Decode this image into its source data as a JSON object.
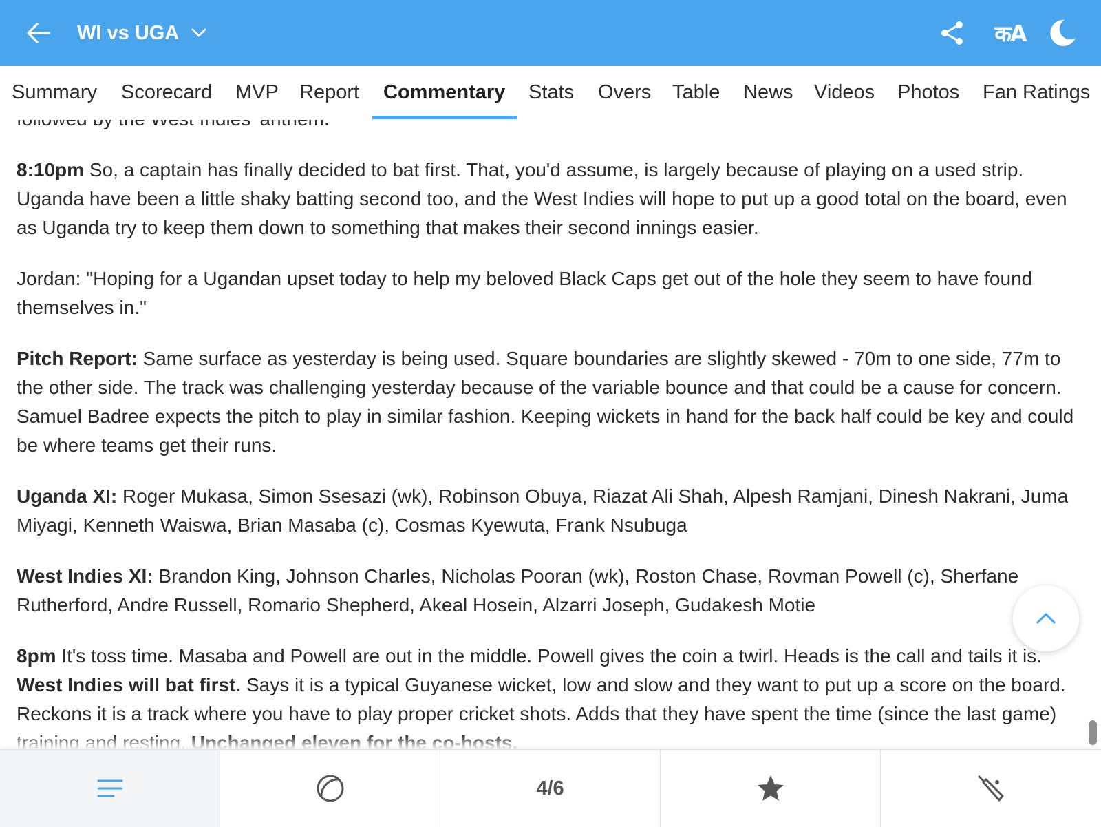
{
  "header": {
    "title": "WI vs UGA",
    "lang_label": "कA",
    "icons": [
      "back-arrow-icon",
      "chevron-down-icon",
      "share-icon",
      "language-icon",
      "dark-mode-moon-icon"
    ],
    "bar_color": "#4aa5ec"
  },
  "tabs": [
    {
      "label": "Summary"
    },
    {
      "label": "Scorecard"
    },
    {
      "label": "MVP"
    },
    {
      "label": "Report"
    },
    {
      "label": "Commentary"
    },
    {
      "label": "Stats"
    },
    {
      "label": "Overs"
    },
    {
      "label": "Table"
    },
    {
      "label": "News"
    },
    {
      "label": "Videos"
    },
    {
      "label": "Photos"
    },
    {
      "label": "Fan Ratings"
    }
  ],
  "active_tab": "Commentary",
  "commentary": {
    "p0": {
      "text": "followed by the West Indies' anthem."
    },
    "p1": {
      "lead": "8:10pm",
      "text": " So, a captain has finally decided to bat first. That, you'd assume, is largely because of playing on a used strip. Uganda have been a little shaky batting second too, and the West Indies will hope to put up a good total on the board, even as Uganda try to keep them down to something that makes their second innings easier."
    },
    "p2": {
      "text": "Jordan: \"Hoping for a Ugandan upset today to help my beloved Black Caps get out of the hole they seem to have found themselves in.\""
    },
    "p3": {
      "lead": "Pitch Report:",
      "text": " Same surface as yesterday is being used. Square boundaries are slightly skewed - 70m to one side, 77m to the other side. The track was challenging yesterday because of the variable bounce and that could be a cause for concern. Samuel Badree expects the pitch to play in similar fashion. Keeping wickets in hand for the back half could be key and could be where teams get their runs."
    },
    "p4": {
      "lead": "Uganda XI:",
      "text": " Roger Mukasa, Simon Ssesazi (wk), Robinson Obuya, Riazat Ali Shah, Alpesh Ramjani, Dinesh Nakrani, Juma Miyagi, Kenneth Waiswa, Brian Masaba (c), Cosmas Kyewuta, Frank Nsubuga"
    },
    "p5": {
      "lead": "West Indies XI:",
      "text": " Brandon King, Johnson Charles, Nicholas Pooran (wk), Roston Chase, Rovman Powell (c), Sherfane Rutherford, Andre Russell, Romario Shepherd, Akeal Hosein, Alzarri Joseph, Gudakesh Motie"
    },
    "p6": {
      "lead": "8pm",
      "text1": " It's toss time. Masaba and Powell are out in the middle. Powell gives the coin a twirl. Heads is the call and tails it is. ",
      "bold2": "West Indies will bat first.",
      "text2": " Says it is a typical Guyanese wicket, low and slow and they want to put up a score on the board. Reckons it is a track where you have to play proper cricket shots. Adds that they have spent the time (since the last game) training and resting. ",
      "bold3": "Unchanged eleven for the co-hosts."
    }
  },
  "bottom_nav": {
    "page_counter": "4/6",
    "icons": [
      "menu-lines-icon",
      "ball-icon",
      "star-icon",
      "cricket-bat-icon"
    ]
  },
  "fab_icon": "chevron-up-icon"
}
